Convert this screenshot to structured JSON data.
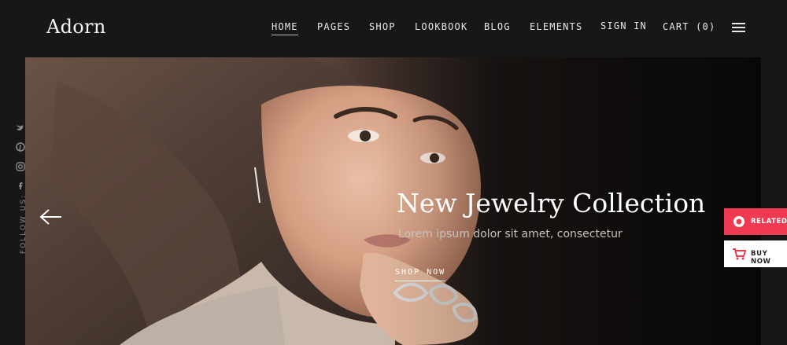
{
  "header": {
    "logo": "Adorn",
    "nav": [
      {
        "label": "HOME",
        "active": true
      },
      {
        "label": "PAGES"
      },
      {
        "label": "SHOP"
      },
      {
        "label": "LOOKBOOK"
      },
      {
        "label": "BLOG"
      },
      {
        "label": "ELEMENTS"
      },
      {
        "label": "SIGN IN"
      },
      {
        "label": "CART (0)"
      }
    ],
    "menu_icon": "hamburger-icon"
  },
  "sidebar": {
    "follow_label": "FOLLOW US:",
    "icons": [
      "twitter-icon",
      "pinterest-icon",
      "instagram-icon",
      "facebook-icon"
    ]
  },
  "hero": {
    "title": "New Jewelry Collection",
    "subtitle": "Lorem ipsum dolor sit amet, consectetur",
    "button": "SHOP NOW",
    "prev_icon": "arrow-left-icon"
  },
  "side_buttons": {
    "related": "RELATED",
    "buy_now": "BUY NOW"
  },
  "colors": {
    "background": "#171717",
    "accent": "#ef3a52",
    "text": "#ffffff"
  }
}
